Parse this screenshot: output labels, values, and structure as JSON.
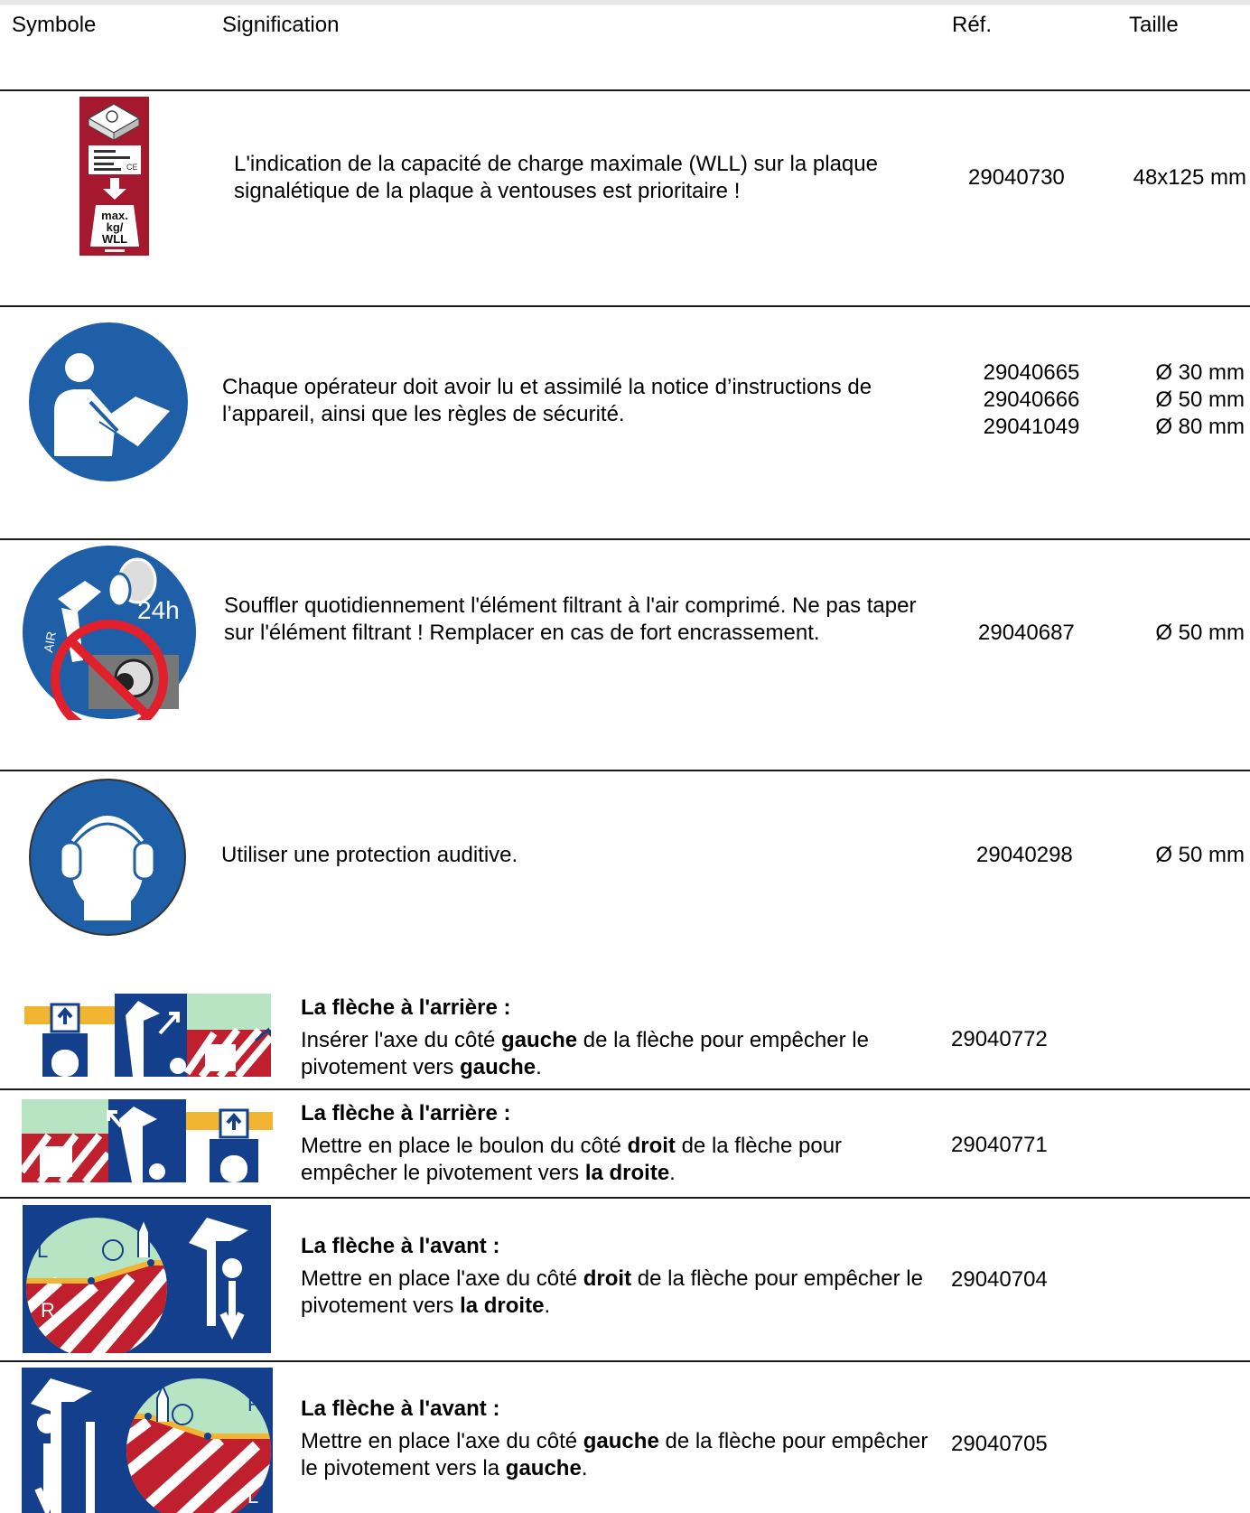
{
  "header": {
    "symbol": "Symbole",
    "meaning": "Signification",
    "ref": "Réf.",
    "size": "Taille"
  },
  "rows": [
    {
      "icon": "max-load-plate-label",
      "icon_text": [
        "max.",
        "kg/",
        "WLL"
      ],
      "desc": "L'indication de la capacité de charge maximale (WLL) sur la plaque signalétique de la plaque à ventouses est prioritaire !",
      "ref": "29040730",
      "size": "48x125 mm"
    },
    {
      "icon": "read-manual-icon",
      "desc": "Chaque opérateur doit avoir lu et assimilé la notice d’instructions de l’appareil, ainsi que les règles de sécurité.",
      "refs": [
        "29040665",
        "29040666",
        "29041049"
      ],
      "sizes": [
        "Ø 30 mm",
        "Ø 50 mm",
        "Ø 80 mm"
      ]
    },
    {
      "icon": "blow-filter-daily-icon",
      "icon_text": [
        "AIR",
        "24h"
      ],
      "desc": "Souffler quotidiennement l'élément filtrant à l'air comprimé. Ne pas taper sur l'élément filtrant ! Remplacer en cas de fort encrassement.",
      "ref": "29040687",
      "size": "Ø 50 mm"
    },
    {
      "icon": "hearing-protection-icon",
      "desc": "Utiliser une protection auditive.",
      "ref": "29040298",
      "size": "Ø 50 mm"
    },
    {
      "icon": "boom-rear-left-pin-label",
      "title": "La flèche à l'arrière :",
      "desc_parts": [
        "Insérer l'axe du côté ",
        "gauche",
        " de la flèche pour empêcher le pivotement vers ",
        "gauche",
        "."
      ],
      "ref": "29040772"
    },
    {
      "icon": "boom-rear-right-pin-label",
      "title": "La flèche à l'arrière :",
      "desc_parts": [
        "Mettre en place le boulon du côté ",
        "droit",
        " de la flèche pour empêcher le pivotement vers ",
        "la droite",
        "."
      ],
      "ref": "29040771"
    },
    {
      "icon": "boom-front-right-pin-label",
      "title": "La flèche à l'avant :",
      "desc_parts": [
        "Mettre en place l'axe du côté ",
        "droit",
        " de la flèche pour empêcher le pivotement vers ",
        "la droite",
        "."
      ],
      "ref": "29040704"
    },
    {
      "icon": "boom-front-left-pin-label",
      "title": "La flèche à l'avant :",
      "desc_parts": [
        "Mettre en place l'axe du côté ",
        "gauche",
        " de la flèche pour empêcher le pivotement vers la ",
        "gauche",
        "."
      ],
      "ref": "29040705"
    }
  ],
  "colors": {
    "label_red": "#a5182d",
    "sign_blue": "#1f5fa8",
    "label_navy": "#143f8c",
    "zone_green": "#b7e4c3",
    "boom_yellow": "#f2b531",
    "stripe_red": "#c0202e"
  }
}
